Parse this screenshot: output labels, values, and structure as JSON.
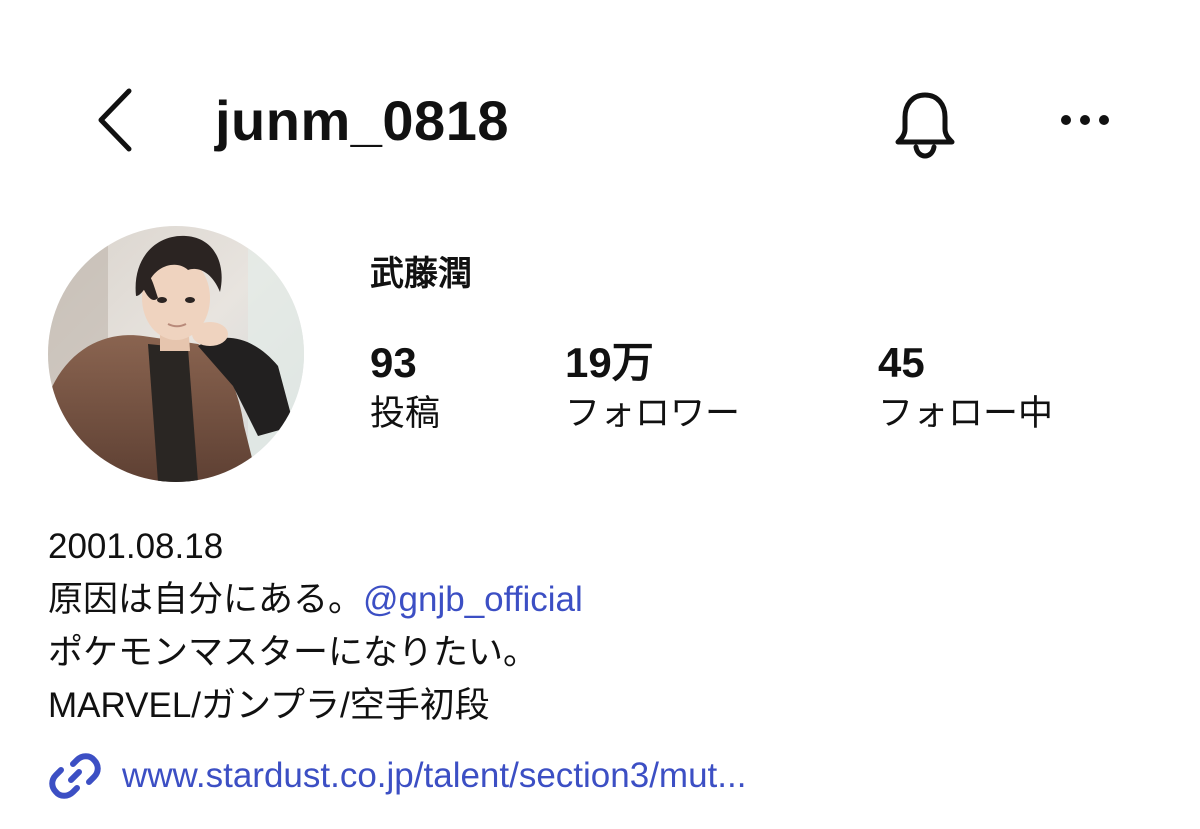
{
  "header": {
    "username": "junm_0818",
    "icons": {
      "back": "chevron-left-icon",
      "notifications": "bell-icon",
      "more": "more-horizontal-icon"
    }
  },
  "profile": {
    "display_name": "武藤潤",
    "stats": [
      {
        "value": "93",
        "label": "投稿"
      },
      {
        "value": "19万",
        "label": "フォロワー"
      },
      {
        "value": "45",
        "label": "フォロー中"
      }
    ]
  },
  "bio": {
    "line1": "2001.08.18",
    "line2_text": "原因は自分にある。",
    "line2_mention": "@gnjb_official",
    "line3": "ポケモンマスターになりたい。",
    "line4": "MARVEL/ガンプラ/空手初段"
  },
  "website": {
    "icon": "link-icon",
    "text": "www.stardust.co.jp/talent/section3/mut..."
  },
  "colors": {
    "text": "#111111",
    "link": "#3c4fc4",
    "background": "#ffffff"
  }
}
